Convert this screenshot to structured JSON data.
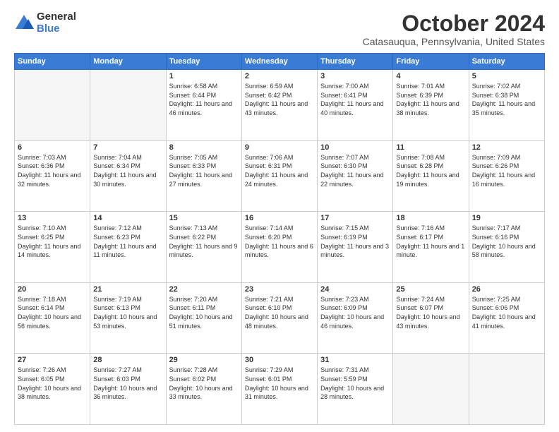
{
  "logo": {
    "general": "General",
    "blue": "Blue"
  },
  "title": "October 2024",
  "location": "Catasauqua, Pennsylvania, United States",
  "days_of_week": [
    "Sunday",
    "Monday",
    "Tuesday",
    "Wednesday",
    "Thursday",
    "Friday",
    "Saturday"
  ],
  "weeks": [
    [
      {
        "day": "",
        "info": ""
      },
      {
        "day": "",
        "info": ""
      },
      {
        "day": "1",
        "info": "Sunrise: 6:58 AM\nSunset: 6:44 PM\nDaylight: 11 hours and 46 minutes."
      },
      {
        "day": "2",
        "info": "Sunrise: 6:59 AM\nSunset: 6:42 PM\nDaylight: 11 hours and 43 minutes."
      },
      {
        "day": "3",
        "info": "Sunrise: 7:00 AM\nSunset: 6:41 PM\nDaylight: 11 hours and 40 minutes."
      },
      {
        "day": "4",
        "info": "Sunrise: 7:01 AM\nSunset: 6:39 PM\nDaylight: 11 hours and 38 minutes."
      },
      {
        "day": "5",
        "info": "Sunrise: 7:02 AM\nSunset: 6:38 PM\nDaylight: 11 hours and 35 minutes."
      }
    ],
    [
      {
        "day": "6",
        "info": "Sunrise: 7:03 AM\nSunset: 6:36 PM\nDaylight: 11 hours and 32 minutes."
      },
      {
        "day": "7",
        "info": "Sunrise: 7:04 AM\nSunset: 6:34 PM\nDaylight: 11 hours and 30 minutes."
      },
      {
        "day": "8",
        "info": "Sunrise: 7:05 AM\nSunset: 6:33 PM\nDaylight: 11 hours and 27 minutes."
      },
      {
        "day": "9",
        "info": "Sunrise: 7:06 AM\nSunset: 6:31 PM\nDaylight: 11 hours and 24 minutes."
      },
      {
        "day": "10",
        "info": "Sunrise: 7:07 AM\nSunset: 6:30 PM\nDaylight: 11 hours and 22 minutes."
      },
      {
        "day": "11",
        "info": "Sunrise: 7:08 AM\nSunset: 6:28 PM\nDaylight: 11 hours and 19 minutes."
      },
      {
        "day": "12",
        "info": "Sunrise: 7:09 AM\nSunset: 6:26 PM\nDaylight: 11 hours and 16 minutes."
      }
    ],
    [
      {
        "day": "13",
        "info": "Sunrise: 7:10 AM\nSunset: 6:25 PM\nDaylight: 11 hours and 14 minutes."
      },
      {
        "day": "14",
        "info": "Sunrise: 7:12 AM\nSunset: 6:23 PM\nDaylight: 11 hours and 11 minutes."
      },
      {
        "day": "15",
        "info": "Sunrise: 7:13 AM\nSunset: 6:22 PM\nDaylight: 11 hours and 9 minutes."
      },
      {
        "day": "16",
        "info": "Sunrise: 7:14 AM\nSunset: 6:20 PM\nDaylight: 11 hours and 6 minutes."
      },
      {
        "day": "17",
        "info": "Sunrise: 7:15 AM\nSunset: 6:19 PM\nDaylight: 11 hours and 3 minutes."
      },
      {
        "day": "18",
        "info": "Sunrise: 7:16 AM\nSunset: 6:17 PM\nDaylight: 11 hours and 1 minute."
      },
      {
        "day": "19",
        "info": "Sunrise: 7:17 AM\nSunset: 6:16 PM\nDaylight: 10 hours and 58 minutes."
      }
    ],
    [
      {
        "day": "20",
        "info": "Sunrise: 7:18 AM\nSunset: 6:14 PM\nDaylight: 10 hours and 56 minutes."
      },
      {
        "day": "21",
        "info": "Sunrise: 7:19 AM\nSunset: 6:13 PM\nDaylight: 10 hours and 53 minutes."
      },
      {
        "day": "22",
        "info": "Sunrise: 7:20 AM\nSunset: 6:11 PM\nDaylight: 10 hours and 51 minutes."
      },
      {
        "day": "23",
        "info": "Sunrise: 7:21 AM\nSunset: 6:10 PM\nDaylight: 10 hours and 48 minutes."
      },
      {
        "day": "24",
        "info": "Sunrise: 7:23 AM\nSunset: 6:09 PM\nDaylight: 10 hours and 46 minutes."
      },
      {
        "day": "25",
        "info": "Sunrise: 7:24 AM\nSunset: 6:07 PM\nDaylight: 10 hours and 43 minutes."
      },
      {
        "day": "26",
        "info": "Sunrise: 7:25 AM\nSunset: 6:06 PM\nDaylight: 10 hours and 41 minutes."
      }
    ],
    [
      {
        "day": "27",
        "info": "Sunrise: 7:26 AM\nSunset: 6:05 PM\nDaylight: 10 hours and 38 minutes."
      },
      {
        "day": "28",
        "info": "Sunrise: 7:27 AM\nSunset: 6:03 PM\nDaylight: 10 hours and 36 minutes."
      },
      {
        "day": "29",
        "info": "Sunrise: 7:28 AM\nSunset: 6:02 PM\nDaylight: 10 hours and 33 minutes."
      },
      {
        "day": "30",
        "info": "Sunrise: 7:29 AM\nSunset: 6:01 PM\nDaylight: 10 hours and 31 minutes."
      },
      {
        "day": "31",
        "info": "Sunrise: 7:31 AM\nSunset: 5:59 PM\nDaylight: 10 hours and 28 minutes."
      },
      {
        "day": "",
        "info": ""
      },
      {
        "day": "",
        "info": ""
      }
    ]
  ]
}
